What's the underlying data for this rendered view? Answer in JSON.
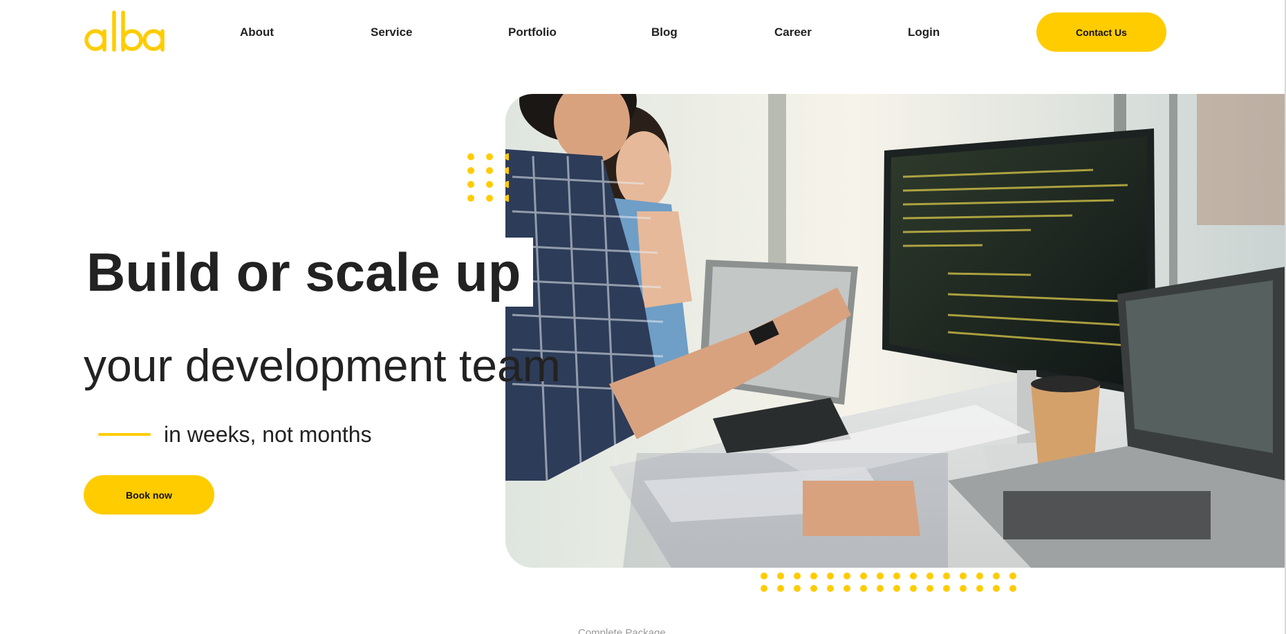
{
  "brand": {
    "logo_text": "alba",
    "accent_color": "#ffcc00"
  },
  "nav": {
    "items": [
      {
        "label": "About"
      },
      {
        "label": "Service"
      },
      {
        "label": "Portfolio"
      },
      {
        "label": "Blog"
      },
      {
        "label": "Career"
      },
      {
        "label": "Login"
      }
    ],
    "contact_label": "Contact Us"
  },
  "hero": {
    "title": "Build or scale up",
    "subtitle": "your development team",
    "tagline": "in weeks, not months",
    "cta_label": "Book now",
    "image_description_icon": "developers-at-computer-photo"
  },
  "next_section": {
    "label": "Complete Package"
  }
}
